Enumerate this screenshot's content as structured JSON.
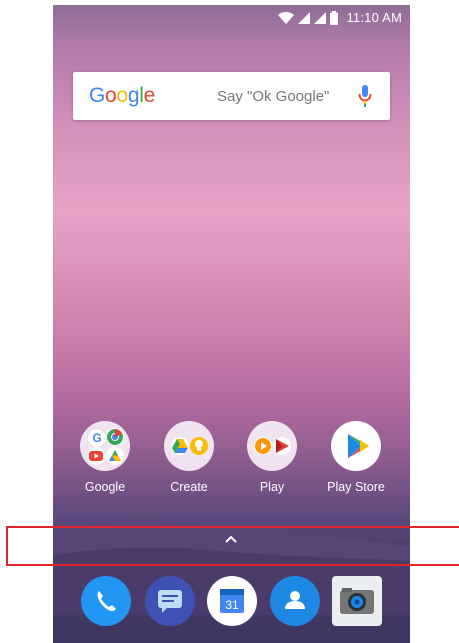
{
  "status_bar": {
    "time": "11:10 AM",
    "icons": [
      "wifi-icon",
      "signal-icon",
      "signal-icon",
      "battery-icon"
    ]
  },
  "search_widget": {
    "logo_text": "Google",
    "hint": "Say \"Ok Google\"",
    "mic_icon": "mic-icon"
  },
  "home_apps": [
    {
      "label": "Google",
      "type": "folder"
    },
    {
      "label": "Create",
      "type": "folder"
    },
    {
      "label": "Play",
      "type": "folder"
    },
    {
      "label": "Play Store",
      "type": "app"
    }
  ],
  "drawer_handle": {
    "icon": "chevron-up-icon"
  },
  "dock": [
    {
      "name": "phone",
      "icon": "phone-icon",
      "color": "#2196F3"
    },
    {
      "name": "messages",
      "icon": "message-icon",
      "color": "#3F51B5"
    },
    {
      "name": "calendar",
      "icon": "calendar-icon",
      "color": "#4285F4",
      "day": "31"
    },
    {
      "name": "contacts",
      "icon": "contacts-icon",
      "color": "#1E88E5"
    },
    {
      "name": "camera",
      "icon": "camera-icon",
      "color": "#9E9E9E"
    }
  ],
  "colors": {
    "highlight": "#e0262b",
    "google_blue": "#4285F4",
    "google_red": "#EA4335",
    "google_yellow": "#FBBC05",
    "google_green": "#34A853"
  }
}
